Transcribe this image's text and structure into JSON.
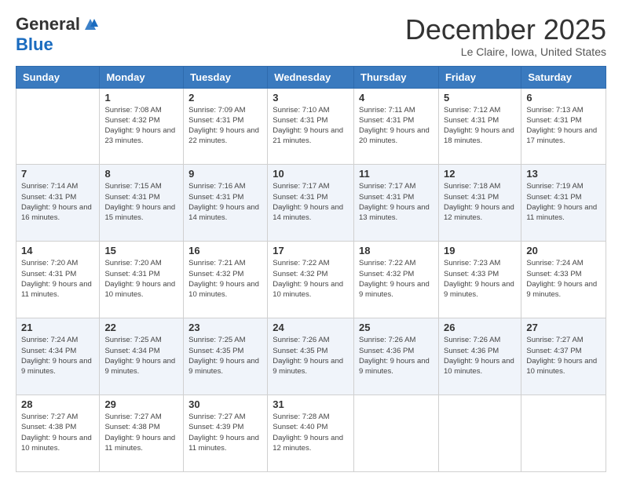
{
  "header": {
    "logo_general": "General",
    "logo_blue": "Blue",
    "month_title": "December 2025",
    "location": "Le Claire, Iowa, United States"
  },
  "weekdays": [
    "Sunday",
    "Monday",
    "Tuesday",
    "Wednesday",
    "Thursday",
    "Friday",
    "Saturday"
  ],
  "weeks": [
    [
      {
        "day": "",
        "sunrise": "",
        "sunset": "",
        "daylight": ""
      },
      {
        "day": "1",
        "sunrise": "Sunrise: 7:08 AM",
        "sunset": "Sunset: 4:32 PM",
        "daylight": "Daylight: 9 hours and 23 minutes."
      },
      {
        "day": "2",
        "sunrise": "Sunrise: 7:09 AM",
        "sunset": "Sunset: 4:31 PM",
        "daylight": "Daylight: 9 hours and 22 minutes."
      },
      {
        "day": "3",
        "sunrise": "Sunrise: 7:10 AM",
        "sunset": "Sunset: 4:31 PM",
        "daylight": "Daylight: 9 hours and 21 minutes."
      },
      {
        "day": "4",
        "sunrise": "Sunrise: 7:11 AM",
        "sunset": "Sunset: 4:31 PM",
        "daylight": "Daylight: 9 hours and 20 minutes."
      },
      {
        "day": "5",
        "sunrise": "Sunrise: 7:12 AM",
        "sunset": "Sunset: 4:31 PM",
        "daylight": "Daylight: 9 hours and 18 minutes."
      },
      {
        "day": "6",
        "sunrise": "Sunrise: 7:13 AM",
        "sunset": "Sunset: 4:31 PM",
        "daylight": "Daylight: 9 hours and 17 minutes."
      }
    ],
    [
      {
        "day": "7",
        "sunrise": "Sunrise: 7:14 AM",
        "sunset": "Sunset: 4:31 PM",
        "daylight": "Daylight: 9 hours and 16 minutes."
      },
      {
        "day": "8",
        "sunrise": "Sunrise: 7:15 AM",
        "sunset": "Sunset: 4:31 PM",
        "daylight": "Daylight: 9 hours and 15 minutes."
      },
      {
        "day": "9",
        "sunrise": "Sunrise: 7:16 AM",
        "sunset": "Sunset: 4:31 PM",
        "daylight": "Daylight: 9 hours and 14 minutes."
      },
      {
        "day": "10",
        "sunrise": "Sunrise: 7:17 AM",
        "sunset": "Sunset: 4:31 PM",
        "daylight": "Daylight: 9 hours and 14 minutes."
      },
      {
        "day": "11",
        "sunrise": "Sunrise: 7:17 AM",
        "sunset": "Sunset: 4:31 PM",
        "daylight": "Daylight: 9 hours and 13 minutes."
      },
      {
        "day": "12",
        "sunrise": "Sunrise: 7:18 AM",
        "sunset": "Sunset: 4:31 PM",
        "daylight": "Daylight: 9 hours and 12 minutes."
      },
      {
        "day": "13",
        "sunrise": "Sunrise: 7:19 AM",
        "sunset": "Sunset: 4:31 PM",
        "daylight": "Daylight: 9 hours and 11 minutes."
      }
    ],
    [
      {
        "day": "14",
        "sunrise": "Sunrise: 7:20 AM",
        "sunset": "Sunset: 4:31 PM",
        "daylight": "Daylight: 9 hours and 11 minutes."
      },
      {
        "day": "15",
        "sunrise": "Sunrise: 7:20 AM",
        "sunset": "Sunset: 4:31 PM",
        "daylight": "Daylight: 9 hours and 10 minutes."
      },
      {
        "day": "16",
        "sunrise": "Sunrise: 7:21 AM",
        "sunset": "Sunset: 4:32 PM",
        "daylight": "Daylight: 9 hours and 10 minutes."
      },
      {
        "day": "17",
        "sunrise": "Sunrise: 7:22 AM",
        "sunset": "Sunset: 4:32 PM",
        "daylight": "Daylight: 9 hours and 10 minutes."
      },
      {
        "day": "18",
        "sunrise": "Sunrise: 7:22 AM",
        "sunset": "Sunset: 4:32 PM",
        "daylight": "Daylight: 9 hours and 9 minutes."
      },
      {
        "day": "19",
        "sunrise": "Sunrise: 7:23 AM",
        "sunset": "Sunset: 4:33 PM",
        "daylight": "Daylight: 9 hours and 9 minutes."
      },
      {
        "day": "20",
        "sunrise": "Sunrise: 7:24 AM",
        "sunset": "Sunset: 4:33 PM",
        "daylight": "Daylight: 9 hours and 9 minutes."
      }
    ],
    [
      {
        "day": "21",
        "sunrise": "Sunrise: 7:24 AM",
        "sunset": "Sunset: 4:34 PM",
        "daylight": "Daylight: 9 hours and 9 minutes."
      },
      {
        "day": "22",
        "sunrise": "Sunrise: 7:25 AM",
        "sunset": "Sunset: 4:34 PM",
        "daylight": "Daylight: 9 hours and 9 minutes."
      },
      {
        "day": "23",
        "sunrise": "Sunrise: 7:25 AM",
        "sunset": "Sunset: 4:35 PM",
        "daylight": "Daylight: 9 hours and 9 minutes."
      },
      {
        "day": "24",
        "sunrise": "Sunrise: 7:26 AM",
        "sunset": "Sunset: 4:35 PM",
        "daylight": "Daylight: 9 hours and 9 minutes."
      },
      {
        "day": "25",
        "sunrise": "Sunrise: 7:26 AM",
        "sunset": "Sunset: 4:36 PM",
        "daylight": "Daylight: 9 hours and 9 minutes."
      },
      {
        "day": "26",
        "sunrise": "Sunrise: 7:26 AM",
        "sunset": "Sunset: 4:36 PM",
        "daylight": "Daylight: 9 hours and 10 minutes."
      },
      {
        "day": "27",
        "sunrise": "Sunrise: 7:27 AM",
        "sunset": "Sunset: 4:37 PM",
        "daylight": "Daylight: 9 hours and 10 minutes."
      }
    ],
    [
      {
        "day": "28",
        "sunrise": "Sunrise: 7:27 AM",
        "sunset": "Sunset: 4:38 PM",
        "daylight": "Daylight: 9 hours and 10 minutes."
      },
      {
        "day": "29",
        "sunrise": "Sunrise: 7:27 AM",
        "sunset": "Sunset: 4:38 PM",
        "daylight": "Daylight: 9 hours and 11 minutes."
      },
      {
        "day": "30",
        "sunrise": "Sunrise: 7:27 AM",
        "sunset": "Sunset: 4:39 PM",
        "daylight": "Daylight: 9 hours and 11 minutes."
      },
      {
        "day": "31",
        "sunrise": "Sunrise: 7:28 AM",
        "sunset": "Sunset: 4:40 PM",
        "daylight": "Daylight: 9 hours and 12 minutes."
      },
      {
        "day": "",
        "sunrise": "",
        "sunset": "",
        "daylight": ""
      },
      {
        "day": "",
        "sunrise": "",
        "sunset": "",
        "daylight": ""
      },
      {
        "day": "",
        "sunrise": "",
        "sunset": "",
        "daylight": ""
      }
    ]
  ]
}
